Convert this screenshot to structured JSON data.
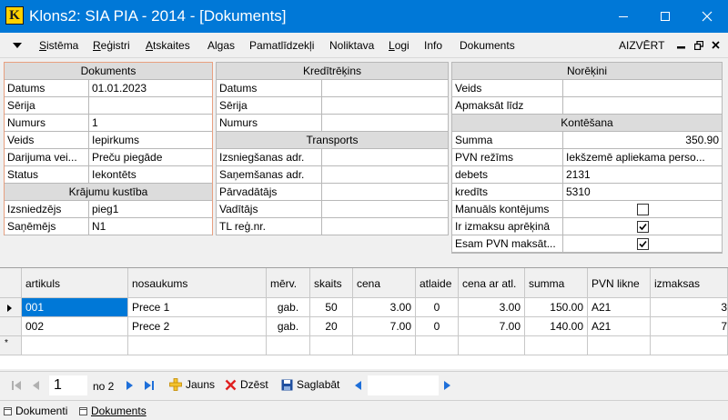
{
  "window": {
    "title": "Klons2: SIA PIA - 2014 - [Dokuments]",
    "icon_letter": "K"
  },
  "menu": {
    "items": [
      "Sistēma",
      "Reģistri",
      "Atskaites",
      "Algas",
      "Pamatlīdzekļi",
      "Noliktava",
      "Logi",
      "Info",
      "Dokuments"
    ],
    "close_label": "AIZVĒRT"
  },
  "dokuments": {
    "header": "Dokuments",
    "fields": [
      {
        "label": "Datums",
        "value": "01.01.2023"
      },
      {
        "label": "Sērija",
        "value": ""
      },
      {
        "label": "Numurs",
        "value": "1"
      },
      {
        "label": "Veids",
        "value": "Iepirkums"
      },
      {
        "label": "Darijuma vei...",
        "value": "Preču piegāde"
      },
      {
        "label": "Status",
        "value": "Iekontēts"
      }
    ],
    "kustiba_header": "Krājumu kustība",
    "kustiba_fields": [
      {
        "label": "Izsniedzējs",
        "value": "pieg1"
      },
      {
        "label": "Saņēmējs",
        "value": "N1"
      }
    ]
  },
  "kreditrekins": {
    "header": "Kredītrēķins",
    "fields": [
      {
        "label": "Datums",
        "value": ""
      },
      {
        "label": "Sērija",
        "value": ""
      },
      {
        "label": "Numurs",
        "value": ""
      }
    ],
    "transports_header": "Transports",
    "transports_fields": [
      {
        "label": "Izsniegšanas adr.",
        "value": ""
      },
      {
        "label": "Saņemšanas adr.",
        "value": ""
      },
      {
        "label": "Pārvadātājs",
        "value": ""
      },
      {
        "label": "Vadītājs",
        "value": ""
      },
      {
        "label": "TL reģ.nr.",
        "value": ""
      }
    ]
  },
  "norekini": {
    "header": "Norēķini",
    "fields": [
      {
        "label": "Veids",
        "value": ""
      },
      {
        "label": "Apmaksāt līdz",
        "value": ""
      }
    ],
    "kontesana_header": "Kontēšana",
    "kontesana_fields": [
      {
        "label": "Summa",
        "value": "350.90"
      },
      {
        "label": "PVN režīms",
        "value": "Iekšzemē apliekama perso..."
      },
      {
        "label": "debets",
        "value": "2131"
      },
      {
        "label": "kredīts",
        "value": "5310"
      }
    ],
    "checkboxes": [
      {
        "label": "Manuāls kontējums",
        "checked": false
      },
      {
        "label": "Ir izmaksu aprēķinā",
        "checked": true
      },
      {
        "label": "Esam PVN maksāt...",
        "checked": true
      }
    ]
  },
  "table": {
    "columns": [
      "artikuls",
      "nosaukums",
      "mērv.",
      "skaits",
      "cena",
      "atlaide",
      "cena ar atl.",
      "summa",
      "PVN likne",
      "izmaksas"
    ],
    "rows": [
      [
        "001",
        "Prece 1",
        "gab.",
        "50",
        "3.00",
        "0",
        "3.00",
        "150.00",
        "A21",
        "3"
      ],
      [
        "002",
        "Prece 2",
        "gab.",
        "20",
        "7.00",
        "0",
        "7.00",
        "140.00",
        "A21",
        "7"
      ]
    ],
    "new_row_marker": "*"
  },
  "navigator": {
    "current_record": "1",
    "total_label": "no 2",
    "new_label": "Jauns",
    "delete_label": "Dzēst",
    "save_label": "Saglabāt"
  },
  "status_tabs": [
    "Dokumenti",
    "Dokuments"
  ],
  "colors": {
    "titlebar": "#0078d7",
    "selection": "#0078d7",
    "section_header": "#dcdcdc",
    "active_border": "#e8a080"
  }
}
